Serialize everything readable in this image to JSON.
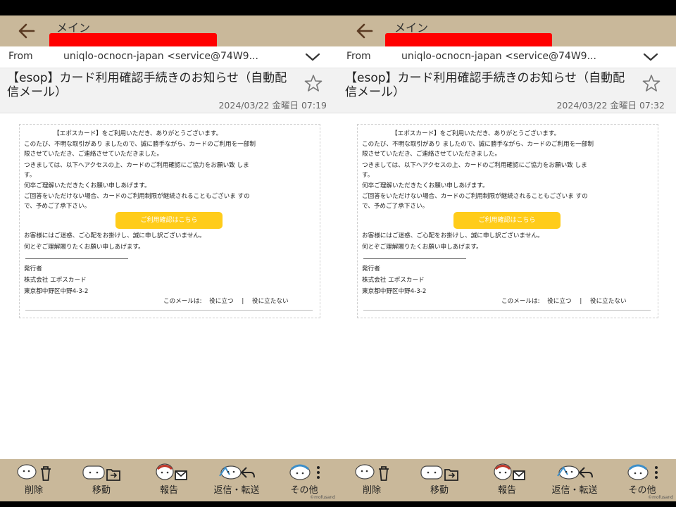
{
  "screens": [
    {
      "header": {
        "mailbox_label": "メイン"
      },
      "from": {
        "label": "From",
        "value": "uniqlo-ocnocn-japan <service@74W9..."
      },
      "subject": "【esop】カード利用確認手続きのお知らせ（自動配信メール）",
      "date": "2024/03/22 金曜日 07:19",
      "email": {
        "greeting": "【エポスカード】をご利用いただき、ありがとうございます。",
        "p1_line1": "このたび、不明な取引があり ましたので、誠に勝手ながら、カードのご利用を一部制",
        "p1_line2": "限させていただき、ご連絡させていただきました。",
        "p2_line1": "つきましては、以下へアクセスの上、カードのご利用確認にご協力をお願い致 しま",
        "p2_line2": "す。",
        "p3": "何卒ご理解いただきたくお願い申しあげます。",
        "p4_line1": "ご回答をいただけない場合、カードのご利用制限が継続されることもございま すの",
        "p4_line2": "で、予めご了承下さい。",
        "cta": "ご利用確認はこちら",
        "p5": "お客様にはご迷惑、ご心配をお掛けし、誠に申し訳ございません。",
        "p6": "何とぞご理解賜りたくお願い申しあげます。",
        "issuer_label": "発行者",
        "company": "株式会社 エポスカード",
        "address": "東京都中野区中野4-3-2",
        "feedback_prompt": "このメールは:",
        "useful": "役に立つ",
        "separator": "|",
        "not_useful": "役に立たない"
      }
    },
    {
      "header": {
        "mailbox_label": "メイン"
      },
      "from": {
        "label": "From",
        "value": "uniqlo-ocnocn-japan <service@74W9..."
      },
      "subject": "【esop】カード利用確認手続きのお知らせ（自動配信メール）",
      "date": "2024/03/22 金曜日 07:32",
      "email": {
        "greeting": "【エポスカード】をご利用いただき、ありがとうございます。",
        "p1_line1": "このたび、不明な取引があり ましたので、誠に勝手ながら、カードのご利用を一部制",
        "p1_line2": "限させていただき、ご連絡させていただきました。",
        "p2_line1": "つきましては、以下へアクセスの上、カードのご利用確認にご協力をお願い致 しま",
        "p2_line2": "す。",
        "p3": "何卒ご理解いただきたくお願い申しあげます。",
        "p4_line1": "ご回答をいただけない場合、カードのご利用制限が継続されることもございま すの",
        "p4_line2": "で、予めご了承下さい。",
        "cta": "ご利用確認はこちら",
        "p5": "お客様にはご迷惑、ご心配をお掛けし、誠に申し訳ございません。",
        "p6": "何とぞご理解賜りたくお願い申しあげます。",
        "issuer_label": "発行者",
        "company": "株式会社 エポスカード",
        "address": "東京都中野区中野4-3-2",
        "feedback_prompt": "このメールは:",
        "useful": "役に立つ",
        "separator": "|",
        "not_useful": "役に立たない"
      }
    }
  ],
  "toolbar": {
    "delete": "削除",
    "move": "移動",
    "report": "報告",
    "reply_forward": "返信・転送",
    "more": "その他",
    "credit": "©mofusand"
  },
  "colors": {
    "header_bg": "#c9b89a",
    "cta_bg": "#ffcc1a",
    "redaction": "#ff0000"
  },
  "icons": [
    "back-arrow-icon",
    "chevron-down-icon",
    "star-icon",
    "trash-icon",
    "folder-move-icon",
    "mail-alert-icon",
    "reply-icon",
    "more-dots-icon"
  ]
}
